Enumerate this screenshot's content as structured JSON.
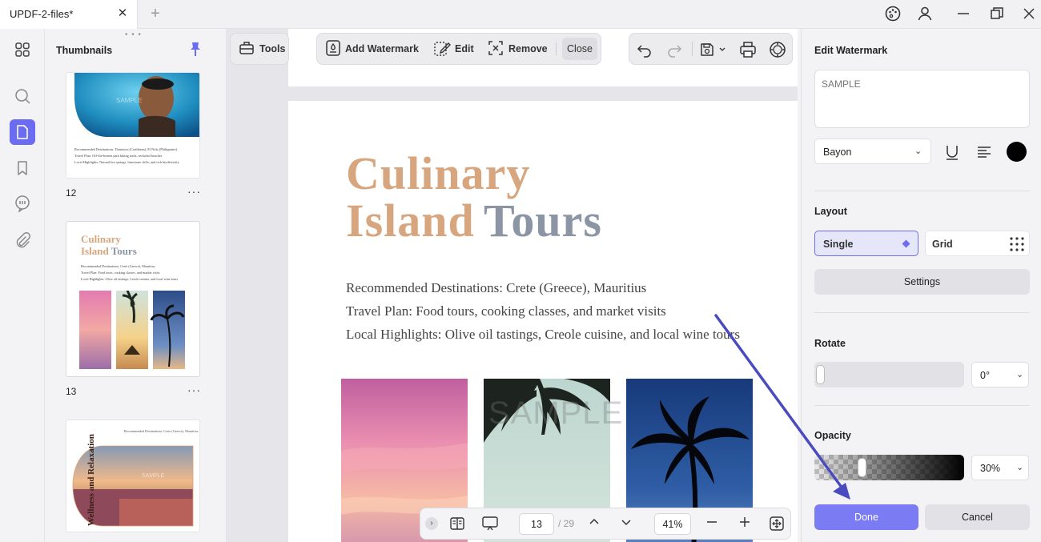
{
  "window": {
    "tab_title": "UPDF-2-files*",
    "tab_close": "✕",
    "tab_add": "+",
    "controls": [
      "palette-icon",
      "account-icon",
      "minimize",
      "restore",
      "close"
    ]
  },
  "thumbnails": {
    "title": "Thumbnails",
    "pages": [
      {
        "number": "12",
        "lines": [
          "Recommended Destinations: Dominica (Caribbean), El Nido (Philippines)",
          "Travel Plan: Off-the-beaten path hiking trails, secluded beaches",
          "Local Highlights: Natural hot springs, limestone cliffs, and rich biodiversity"
        ],
        "watermark": "SAMPLE"
      },
      {
        "number": "13",
        "title_a": "Culinary",
        "title_b": "Island",
        "title_c": "Tours",
        "lines": [
          "Recommended Destinations: Crete (Greece), Mauritius",
          "Travel Plan: Food tours, cooking classes, and market visits",
          "Local Highlights: Olive oil tastings, Creole cuisine, and local wine tours"
        ]
      },
      {
        "number": "",
        "header_line": "Recommended Destinations: Crete (Greece), Mauritius",
        "vertical_title": "Wellness and Relaxation",
        "watermark": "SAMPLE"
      }
    ],
    "more": "···"
  },
  "toolbar": {
    "tools": "Tools",
    "add_watermark": "Add Watermark",
    "edit": "Edit",
    "remove": "Remove",
    "close": "Close"
  },
  "document": {
    "title_line1": "Culinary",
    "title_line2a": "Island",
    "title_line2b": "Tours",
    "lines": [
      "Recommended Destinations: Crete (Greece), Mauritius",
      "Travel Plan: Food tours, cooking classes, and market visits",
      "Local Highlights: Olive oil tastings, Creole cuisine, and local wine tours"
    ],
    "watermark": "SAMPLE"
  },
  "pagebar": {
    "current_page": "13",
    "total": "/ 29",
    "zoom": "41%"
  },
  "panel": {
    "title": "Edit Watermark",
    "watermark_text": "SAMPLE",
    "font": "Bayon",
    "color": "#000000",
    "layout_label": "Layout",
    "layout_single": "Single",
    "layout_grid": "Grid",
    "settings": "Settings",
    "rotate_label": "Rotate",
    "rotate_value": "0°",
    "opacity_label": "Opacity",
    "opacity_value": "30%",
    "opacity_fraction": 0.3,
    "done": "Done",
    "cancel": "Cancel"
  },
  "colors": {
    "accent": "#6c6cf2",
    "done": "#7b7bf4",
    "title_tan": "#d7a57e",
    "title_gray": "#8b95a3",
    "arrow": "#4b4bc0"
  }
}
